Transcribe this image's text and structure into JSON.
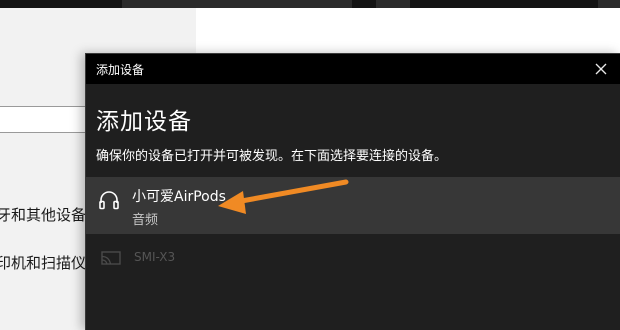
{
  "background_window": {
    "sidebar_items": [
      {
        "label": "蓝牙和其他设备"
      },
      {
        "label": "打印机和扫描仪"
      }
    ]
  },
  "dialog": {
    "titlebar_title": "添加设备",
    "close_icon": "close-icon",
    "heading": "添加设备",
    "description": "确保你的设备已打开并可被发现。在下面选择要连接的设备。",
    "devices": [
      {
        "name": "小可爱AirPods",
        "type": "音频",
        "icon": "headphones-icon"
      },
      {
        "name": "SMI-X3",
        "type": "",
        "icon": "display-icon"
      }
    ]
  },
  "annotation": {
    "arrow_color": "#f08a24"
  }
}
